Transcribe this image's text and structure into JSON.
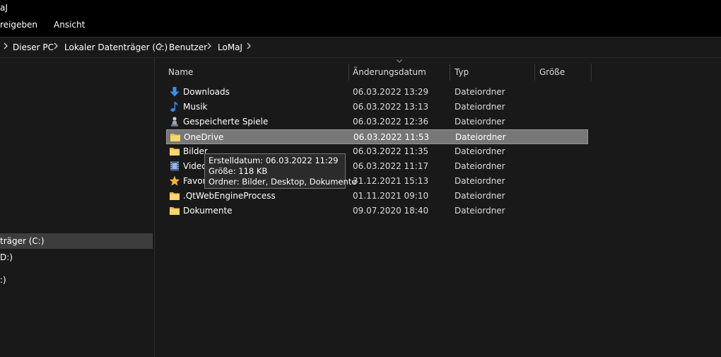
{
  "window": {
    "title": "aJ"
  },
  "ribbon": {
    "tabs": [
      {
        "label": "reigeben"
      },
      {
        "label": "Ansicht"
      }
    ]
  },
  "address": {
    "crumbs": [
      "Dieser PC",
      "Lokaler Datenträger (C:)",
      "Benutzer",
      "LoMaJ"
    ]
  },
  "nav": {
    "items": [
      "träger (C:)",
      "D:)",
      ":)"
    ]
  },
  "columns": {
    "name": "Name",
    "date": "Änderungsdatum",
    "type": "Typ",
    "size": "Größe"
  },
  "files": [
    {
      "name": "Downloads",
      "date": "06.03.2022 13:29",
      "type": "Dateiordner",
      "icon": "download-arrow-icon"
    },
    {
      "name": "Musik",
      "date": "06.03.2022 13:13",
      "type": "Dateiordner",
      "icon": "music-note-icon"
    },
    {
      "name": "Gespeicherte Spiele",
      "date": "06.03.2022 12:36",
      "type": "Dateiordner",
      "icon": "chess-piece-icon"
    },
    {
      "name": "OneDrive",
      "date": "06.03.2022 11:53",
      "type": "Dateiordner",
      "icon": "folder-icon",
      "selected": true
    },
    {
      "name": "Bilder",
      "date": "06.03.2022 11:35",
      "type": "Dateiordner",
      "icon": "folder-icon"
    },
    {
      "name": "Video",
      "date": "06.03.2022 11:17",
      "type": "Dateiordner",
      "icon": "film-icon"
    },
    {
      "name": "Favor",
      "date": "31.12.2021 15:13",
      "type": "Dateiordner",
      "icon": "star-icon"
    },
    {
      "name": ".QtWebEngineProcess",
      "date": "01.11.2021 09:10",
      "type": "Dateiordner",
      "icon": "folder-icon"
    },
    {
      "name": "Dokumente",
      "date": "09.07.2020 18:40",
      "type": "Dateiordner",
      "icon": "folder-icon"
    }
  ],
  "tooltip": {
    "created": "Erstelldatum: 06.03.2022 11:29",
    "size": "Größe: 118 KB",
    "folders": "Ordner: Bilder, Desktop, Dokumente"
  },
  "colors": {
    "selected_row": "#777777",
    "folder": "#f7d66b",
    "download": "#3a8fe0",
    "star": "#f2b233"
  }
}
